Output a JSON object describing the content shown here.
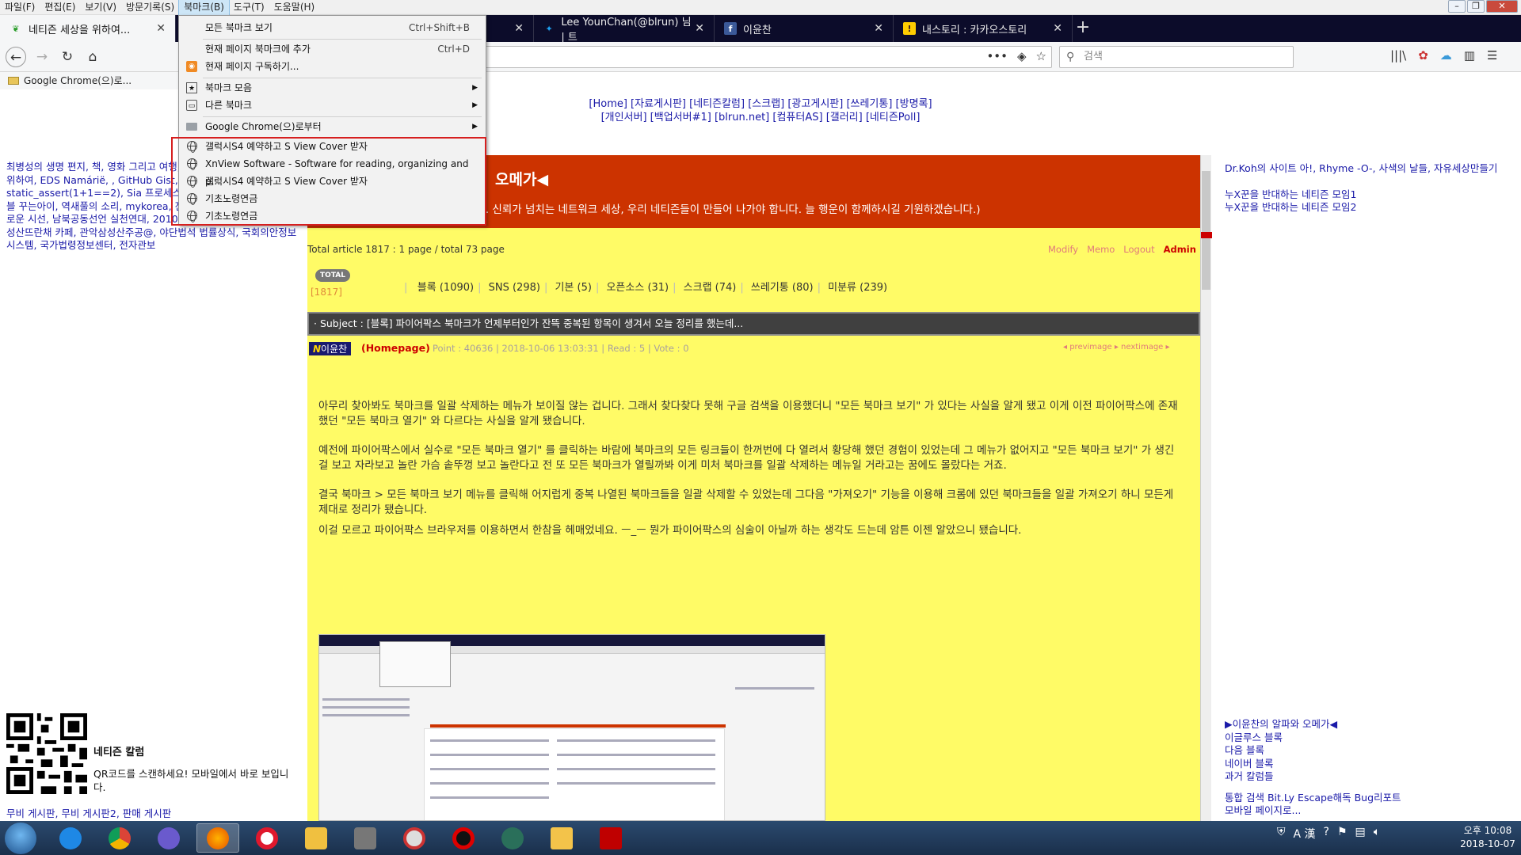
{
  "menubar": {
    "items": [
      "파일(F)",
      "편집(E)",
      "보기(V)",
      "방문기록(S)",
      "북마크(B)",
      "도구(T)",
      "도움말(H)"
    ],
    "active_index": 4
  },
  "tabs": [
    {
      "title": "네티즌 세상을 위하여...",
      "icon": "leaf-icon",
      "selected": true
    },
    {
      "title": "",
      "icon": "none",
      "selected": false
    },
    {
      "title": "Lee YounChan(@blrun) 님 | 트",
      "icon": "twitter-icon",
      "selected": false
    },
    {
      "title": "이윤찬",
      "icon": "facebook-icon",
      "selected": false
    },
    {
      "title": "내스토리 : 카카오스토리",
      "icon": "kakaostory-icon",
      "selected": false
    }
  ],
  "search": {
    "placeholder": "검색"
  },
  "bookmarks_toolbar": {
    "folder": "Google Chrome(으)로..."
  },
  "dropdown": {
    "items": [
      {
        "label": "모든 북마크 보기",
        "shortcut": "Ctrl+Shift+B",
        "icon": "",
        "submenu": false
      },
      {
        "label": "현재 페이지 북마크에 추가",
        "shortcut": "Ctrl+D",
        "icon": "",
        "submenu": false
      },
      {
        "label": "현재 페이지 구독하기...",
        "shortcut": "",
        "icon": "rss-icon",
        "submenu": false
      },
      {
        "label": "북마크 모음",
        "shortcut": "",
        "icon": "bookmark-toolbar-icon",
        "submenu": true
      },
      {
        "label": "다른 북마크",
        "shortcut": "",
        "icon": "other-bookmarks-icon",
        "submenu": true
      },
      {
        "label": "Google Chrome(으)로부터",
        "shortcut": "",
        "icon": "folder-icon",
        "submenu": true
      },
      {
        "label": "갤럭시S4 예약하고 S View Cover 받자",
        "shortcut": "",
        "icon": "globe-icon",
        "submenu": false
      },
      {
        "label": "XnView Software - Software for reading, organizing and p...",
        "shortcut": "",
        "icon": "globe-icon",
        "submenu": false
      },
      {
        "label": "갤럭시S4 예약하고 S View Cover 받자",
        "shortcut": "",
        "icon": "globe-icon",
        "submenu": false
      },
      {
        "label": "기초노령연금",
        "shortcut": "",
        "icon": "globe-icon",
        "submenu": false
      },
      {
        "label": "기초노령연금",
        "shortcut": "",
        "icon": "globe-icon",
        "submenu": false
      }
    ]
  },
  "page": {
    "topnav_line1": "[Home] [자료게시판] [네티즌칼럼] [스크랩] [광고게시판] [쓰레기통] [방명록]",
    "topnav_line2": "[개인서버] [백업서버#1] [blrun.net] [컴퓨터AS] [갤러리] [네티즌Poll]",
    "left_links": "최병성의 생명 편지, 책, 영화 그리고 여행, 아이엠피터, 새로운 세상을 위하여, EDS Namárië, , GitHub Gist, RuBisCO의 폴리네, static_assert(1+1==2), Sia 프로세스 자료천국, 수여니 수정이네 블 꾸는아이, 역새풀의 소리, mykorea, 진짜 국의 선택, 뉴스타파, 새로운 시선, 남북공동선언 실천연대, 2010 마케터의 아이디어 Lab, 삼성산뜨란채 카페, 관악삼성산주공@, 야단법석 법률상식, 국회의안정보시스템, 국가법령정보센터, 전자관보",
    "qr_title": "네티즌 칼럼",
    "qr_text": "QR코드를 스캔하세요! 모바일에서 바로 보입니다.",
    "left_bottom": "무비 게시판, 무비 게시판2, 판매 게시판",
    "banner_title": "오메가◀",
    "banner_text": "니다. 신뢰가 넘치는 네트워크 세상, 우리 네티즌들이 만들어 나가야 합니다. 늘 행운이 함께하시길 기원하겠습니다.)",
    "total_article": "Total article 1817 :   1 page / total 73 page",
    "admin_links": [
      "Modify",
      "Memo",
      "Logout",
      "Admin"
    ],
    "total_badge": "TOTAL",
    "total_count": "[1817]",
    "categories": [
      "블록 (1090)",
      "SNS (298)",
      "기본 (5)",
      "오픈소스 (31)",
      "스크랩 (74)",
      "쓰레기통 (80)",
      "미분류 (239)"
    ],
    "subject": "· Subject : [블록] 파이어팍스 북마크가 언제부터인가 잔뜩 중복된 항목이 생겨서 오늘 정리를 했는데...",
    "author": "이윤찬",
    "author_initial": "N",
    "homepage": "(Homepage)",
    "meta": "Point : 40636   |   2018-10-06 13:03:31   |   Read : 5   |   Vote : 0",
    "prevnext": "◂ previmage   ▸ nextimage ▸",
    "paragraphs": [
      "아무리 찾아봐도 북마크를 일괄 삭제하는 메뉴가 보이질 않는 겁니다. 그래서 찾다찾다 못해 구글 검색을 이용했더니 \"모든 북마크 보기\" 가 있다는 사실을 알게 됐고 이게 이전 파이어팍스에 존재했던 \"모든 북마크 열기\" 와 다르다는 사실을 알게 됐습니다.",
      "예전에 파이어팍스에서 실수로 \"모든 북마크 열기\" 를 클릭하는 바람에 북마크의 모든 링크들이 한꺼번에 다 열려서 황당해 했던 경험이 있었는데 그 메뉴가 없어지고 \"모든 북마크 보기\" 가 생긴 걸 보고 자라보고 놀란 가슴 솥뚜껑 보고 놀란다고 전 또 모든 북마크가 열릴까봐 이게 미처 북마크를 일괄 삭제하는 메뉴일 거라고는 꿈에도 몰랐다는 거죠.",
      "결국 북마크 > 모든 북마크 보기 메뉴를 클릭해 어지럽게 중복 나열된 북마크들을 일괄 삭제할 수 있었는데 그다음 \"가져오기\" 기능을 이용해 크롬에 있던 북마크들을 일괄 가져오기 하니 모든게 제대로 정리가 됐습니다.",
      "이걸 모르고 파이어팍스 브라우저를 이용하면서 한참을 헤매었네요. ㅡ_ㅡ 뭔가 파이어팍스의 심술이 아닐까 하는 생각도 드는데 암튼 이젠 알았으니 됐습니다."
    ],
    "right_links": "Dr.Koh의 사이트 아!, Rhyme -O-, 사색의 날들, 자유세상만들기",
    "right_group1": [
      "누X꾼을 반대하는 네티즌 모임1",
      "누X꾼을 반대하는 네티즌 모임2"
    ],
    "right_group2": [
      "▶이윤찬의 알파와 오메가◀",
      "이글루스 블록",
      "다음 블록",
      "네이버 블록",
      "과거 칼럼들"
    ],
    "right_group3": [
      "통합 검색 Bit.Ly Escape해독 Bug리포트",
      "모바일 페이지로..."
    ]
  },
  "taskbar": {
    "apps": [
      "internet-explorer-icon",
      "chrome-icon",
      "app-icon",
      "firefox-icon",
      "opera-icon",
      "pen-app-icon",
      "app-icon",
      "app-icon",
      "record-icon",
      "app-icon",
      "folder-icon",
      "filezilla-icon"
    ],
    "active_index": 3,
    "tray_lang": "A 漢",
    "clock_time": "오후 10:08",
    "clock_date": "2018-10-07"
  }
}
